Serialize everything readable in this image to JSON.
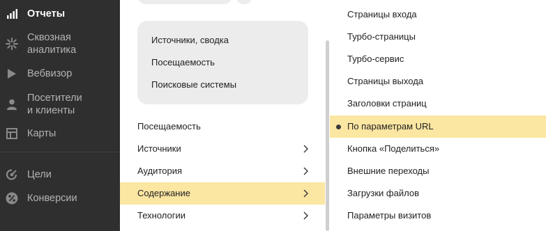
{
  "sidebar": {
    "items": [
      {
        "label": "Отчеты",
        "icon": "bar-chart-icon",
        "active": true
      },
      {
        "label": "Сквозная\nаналитика",
        "icon": "cross-analytics-icon",
        "active": false
      },
      {
        "label": "Вебвизор",
        "icon": "play-icon",
        "active": false
      },
      {
        "label": "Посетители\nи клиенты",
        "icon": "user-icon",
        "active": false
      },
      {
        "label": "Карты",
        "icon": "map-icon",
        "active": false
      },
      {
        "label": "Цели",
        "icon": "target-icon",
        "active": false
      },
      {
        "label": "Конверсии",
        "icon": "percent-icon",
        "active": false
      }
    ]
  },
  "middle": {
    "card_items": [
      "Источники, сводка",
      "Посещаемость",
      "Поисковые системы"
    ],
    "menu": [
      {
        "label": "Посещаемость",
        "has_submenu": false
      },
      {
        "label": "Источники",
        "has_submenu": true
      },
      {
        "label": "Аудитория",
        "has_submenu": true
      },
      {
        "label": "Содержание",
        "has_submenu": true,
        "selected": true
      },
      {
        "label": "Технологии",
        "has_submenu": true
      }
    ]
  },
  "right": {
    "items": [
      {
        "label": "Страницы входа"
      },
      {
        "label": "Турбо-страницы"
      },
      {
        "label": "Турбо-сервис"
      },
      {
        "label": "Страницы выхода"
      },
      {
        "label": "Заголовки страниц"
      },
      {
        "label": "По параметрам URL",
        "selected": true
      },
      {
        "label": "Кнопка «Поделиться»"
      },
      {
        "label": "Внешние переходы"
      },
      {
        "label": "Загрузки файлов"
      },
      {
        "label": "Параметры визитов"
      }
    ]
  },
  "colors": {
    "sidebar_bg": "#2f2f2f",
    "highlight": "#fbe6a2",
    "card_bg": "#ececec"
  }
}
